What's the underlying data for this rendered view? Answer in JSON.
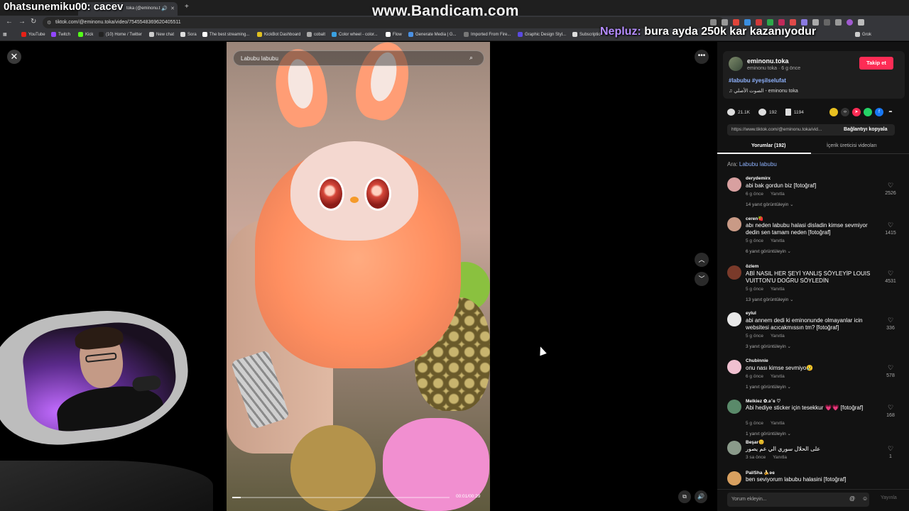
{
  "overlay": {
    "streamer_line": "0hatsunemiku00: cacev",
    "watermark": "www.Bandicam.com",
    "chat_user": "Nepluz:",
    "chat_text": " bura ayda 250k kar kazanıyodur"
  },
  "browser": {
    "tab_title": "toka (@eminonu.t",
    "url": "tiktok.com/@eminonu.toka/video/7545548369620405511",
    "bookmarks": [
      "YouTube",
      "Twitch",
      "Kick",
      "(10) Home / Twitter",
      "New chat",
      "Sora",
      "The best streaming...",
      "KickBot Dashboard",
      "cobalt",
      "Color wheel - color...",
      "Flow",
      "Generate Media | G...",
      "Imported From Fire...",
      "Graphic Design Styl...",
      "Subscriptio",
      "Grok"
    ]
  },
  "video": {
    "search_placeholder": "Labubu labubu",
    "time": "00:01/00:29",
    "progress": 0.04
  },
  "post": {
    "author": "eminonu.toka",
    "author_sub": "eminonu toka · 6 g önce",
    "follow_label": "Takip et",
    "hashtags": "#labubu #yeşilselufat",
    "sound": "♫  الصوت الأصلي - eminonu toka",
    "likes": "21.1K",
    "comments_count": "192",
    "saves": "1194",
    "link": "https://www.tiktok.com/@eminonu.toka/vid...",
    "copy_label": "Bağlantıyı kopyala",
    "tab_comments": "Yorumlar (192)",
    "tab_creator": "İçerik üreticisi videoları",
    "search_prefix": "Ara: ",
    "search_query": "Labubu labubu"
  },
  "comments": [
    {
      "user": "derydemirx",
      "text": "abi bak gordun biz [fotoğraf]",
      "meta": "6 g önce",
      "reply": "Yanıtla",
      "replies": "14 yanıt görüntüleyin ⌄",
      "likes": "2526",
      "color": "#d8a0a0"
    },
    {
      "user": "ceren🍓",
      "text": "abı neden labubu halasi disladin kimse sevmiyor dedin sen tamam neden [fotoğraf]",
      "meta": "5 g önce",
      "reply": "Yanıtla",
      "replies": "6 yanıt görüntüleyin ⌄",
      "likes": "1415",
      "color": "#c99a86"
    },
    {
      "user": "özlem",
      "text": "ABİ NASIL HER ŞEYİ YANLIŞ SÖYLEYİP LOUIS VUITTON'U DOĞRU SÖYLEDİN",
      "meta": "5 g önce",
      "reply": "Yanıtla",
      "replies": "13 yanıt görüntüleyin ⌄",
      "likes": "4531",
      "color": "#7a3a2a"
    },
    {
      "user": "eylul",
      "text": "abi annem dedi ki eminonunde olmayanlar icin websitesi acıcakmıssın tm? [fotoğraf]",
      "meta": "5 g önce",
      "reply": "Yanıtla",
      "replies": "3 yanıt görüntüleyin ⌄",
      "likes": "336",
      "color": "#e8e8e8"
    },
    {
      "user": "Chubinnie",
      "text": "onu nası kimse sevmiyo😢",
      "meta": "6 g önce",
      "reply": "Yanıtla",
      "replies": "1 yanıt görüntüleyin ⌄",
      "likes": "578",
      "color": "#f0c0d0"
    },
    {
      "user": "Melkiez ✿.ʚ˚ɞ ♡",
      "text": "Abi hediye sticker için tesekkur 💗💗 [fotoğraf]",
      "meta": "5 g önce",
      "reply": "Yanıtla",
      "replies": "1 yanıt görüntüleyin ⌄",
      "likes": "168",
      "color": "#5a8a6a"
    },
    {
      "user": "Beşar😊",
      "text": "على الحلال سوري الي عم يصور",
      "meta": "3 sa önce",
      "reply": "Yanıtla",
      "replies": "",
      "likes": "1",
      "color": "#8a9a8a"
    },
    {
      "user": "Pal/Sha 🍌ʚɞ",
      "text": "ben seviyorum labubu halasini [fotoğraf]",
      "meta": "",
      "reply": "",
      "replies": "",
      "likes": "",
      "color": "#d8a060"
    }
  ],
  "input": {
    "placeholder": "Yorum ekleyin...",
    "post_label": "Yayınla"
  }
}
